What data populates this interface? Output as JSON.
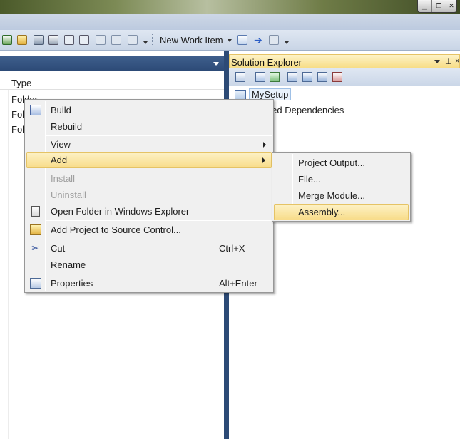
{
  "window": {
    "buttons": [
      "minimize",
      "restore",
      "close"
    ]
  },
  "toolbar": {
    "new_work_item_label": "New Work Item"
  },
  "left_pane": {
    "column_header": "Type",
    "rows": [
      "Folder",
      "Fol",
      "Fol"
    ]
  },
  "solution_explorer": {
    "title": "Solution Explorer",
    "pin_glyph": "⊥",
    "close_glyph": "×",
    "tree_root": "MySetup",
    "tree_child": "etected Dependencies"
  },
  "context_menu": {
    "items": [
      {
        "label": "Build",
        "icon": "build-icon"
      },
      {
        "label": "Rebuild"
      },
      {
        "label": "View",
        "submenu": true
      },
      {
        "label": "Add",
        "submenu": true,
        "highlighted": true
      },
      {
        "label": "Install",
        "disabled": true
      },
      {
        "label": "Uninstall",
        "disabled": true
      },
      {
        "label": "Open Folder in Windows Explorer",
        "icon": "open-folder-icon"
      },
      {
        "label": "Add Project to Source Control...",
        "icon": "source-control-icon"
      },
      {
        "label": "Cut",
        "shortcut": "Ctrl+X",
        "icon": "cut-icon"
      },
      {
        "label": "Rename"
      },
      {
        "label": "Properties",
        "shortcut": "Alt+Enter",
        "icon": "properties-icon"
      }
    ]
  },
  "submenu": {
    "items": [
      {
        "label": "Project Output..."
      },
      {
        "label": "File..."
      },
      {
        "label": "Merge Module..."
      },
      {
        "label": "Assembly...",
        "highlighted": true
      }
    ]
  },
  "colors": {
    "highlight": "#f8dc8a",
    "highlight_border": "#e5c365",
    "pane_header": "#2c4a76",
    "menu_bg": "#f0f0f0"
  }
}
